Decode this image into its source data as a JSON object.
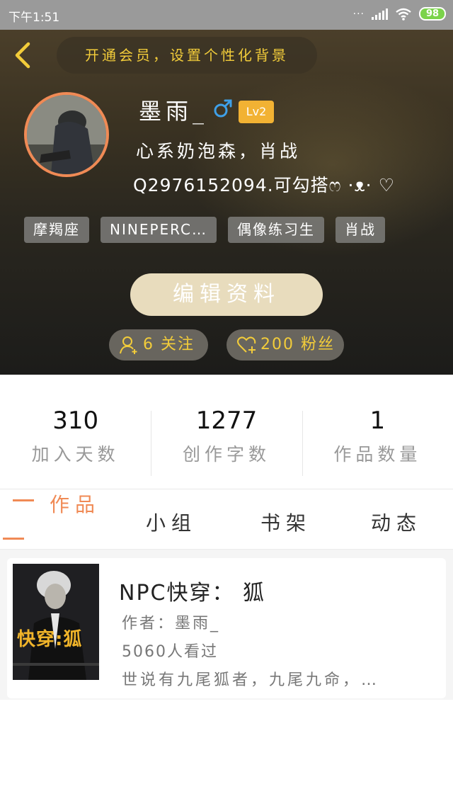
{
  "status_bar": {
    "time": "下午1:51",
    "battery": "98",
    "signal_icon": "signal-bars-icon",
    "wifi_icon": "wifi-icon"
  },
  "header": {
    "back_icon": "chevron-left-icon",
    "vip_banner": "开通会员，设置个性化背景",
    "username": "墨雨_",
    "gender_icon": "male-icon",
    "level": "Lv2",
    "bio_line1": "心系奶泡森，肖战",
    "bio_line2": "Q2976152094.可勾搭ෆ ·ᴥ· ♡",
    "tags": [
      "摩羯座",
      "NINEPERC…",
      "偶像练习生",
      "肖战"
    ],
    "edit_button": "编辑资料",
    "following": "6 关注",
    "fans": "200 粉丝",
    "accent_color": "#f2cc3a"
  },
  "stats": [
    {
      "value": "310",
      "label": "加入天数"
    },
    {
      "value": "1277",
      "label": "创作字数"
    },
    {
      "value": "1",
      "label": "作品数量"
    }
  ],
  "tabs": {
    "works": "作品",
    "groups": "小组",
    "bookshelf": "书架",
    "moments": "动态",
    "active_color": "#f08a55"
  },
  "works": [
    {
      "cover_text": "快穿:狐",
      "title": "NPC快穿：  狐",
      "author": "作者：墨雨_",
      "views": "5060人看过",
      "description": "世说有九尾狐者，九尾九命，…"
    }
  ]
}
